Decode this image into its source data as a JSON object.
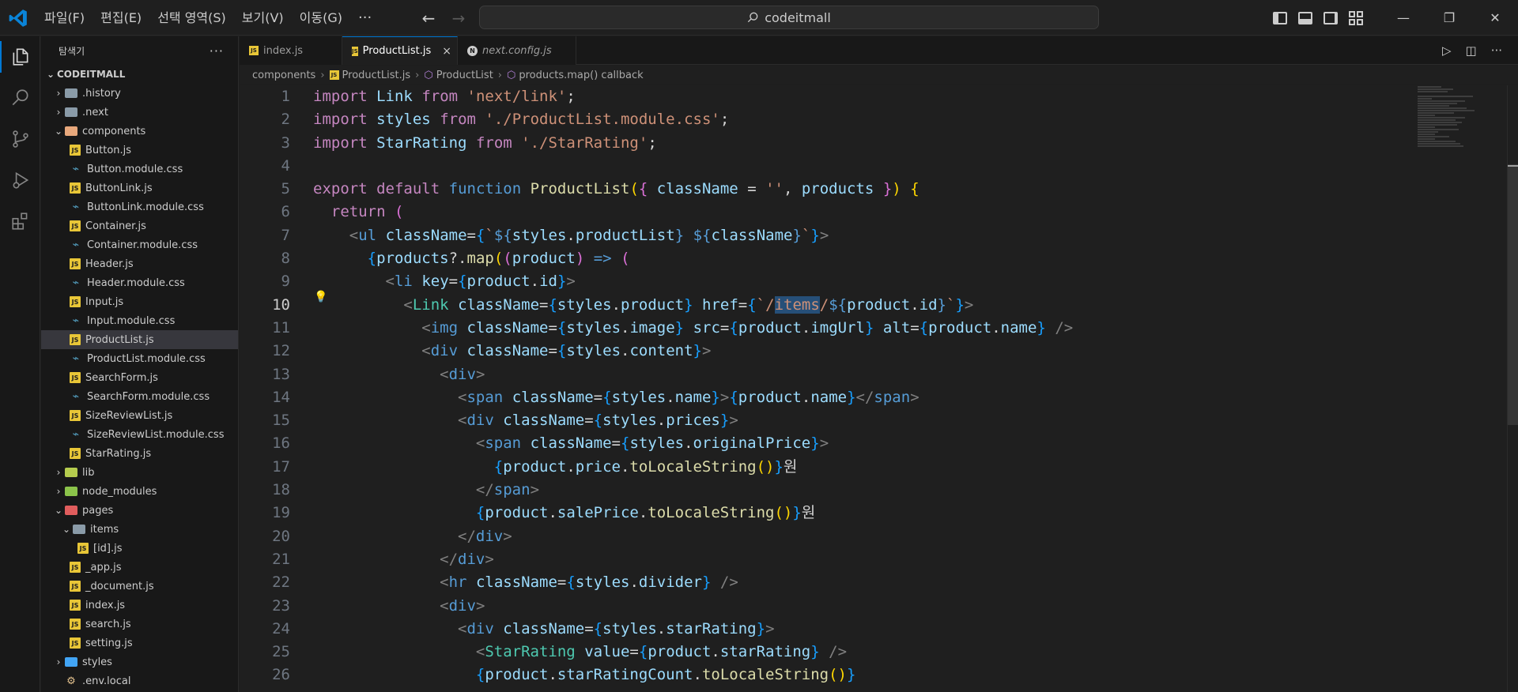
{
  "titlebar": {
    "menu": [
      "파일(F)",
      "편집(E)",
      "선택 영역(S)",
      "보기(V)",
      "이동(G)"
    ],
    "more": "···",
    "search": "codeitmall",
    "controls": {
      "minimize": "—",
      "maximize": "❐",
      "close": "✕"
    }
  },
  "sidebar": {
    "title": "탐색기",
    "more": "···",
    "root": "CODEITMALL",
    "items": [
      {
        "label": ".history",
        "type": "folder",
        "depth": 1,
        "chevron": "›",
        "color": "#8a9ba8"
      },
      {
        "label": ".next",
        "type": "folder",
        "depth": 1,
        "chevron": "›",
        "color": "#8a9ba8"
      },
      {
        "label": "components",
        "type": "folder",
        "depth": 1,
        "chevron": "⌄",
        "color": "#e8a87c"
      },
      {
        "label": "Button.js",
        "type": "js",
        "depth": 2
      },
      {
        "label": "Button.module.css",
        "type": "css",
        "depth": 2
      },
      {
        "label": "ButtonLink.js",
        "type": "js",
        "depth": 2
      },
      {
        "label": "ButtonLink.module.css",
        "type": "css",
        "depth": 2
      },
      {
        "label": "Container.js",
        "type": "js",
        "depth": 2
      },
      {
        "label": "Container.module.css",
        "type": "css",
        "depth": 2
      },
      {
        "label": "Header.js",
        "type": "js",
        "depth": 2
      },
      {
        "label": "Header.module.css",
        "type": "css",
        "depth": 2
      },
      {
        "label": "Input.js",
        "type": "js",
        "depth": 2
      },
      {
        "label": "Input.module.css",
        "type": "css",
        "depth": 2
      },
      {
        "label": "ProductList.js",
        "type": "js",
        "depth": 2,
        "selected": true
      },
      {
        "label": "ProductList.module.css",
        "type": "css",
        "depth": 2
      },
      {
        "label": "SearchForm.js",
        "type": "js",
        "depth": 2
      },
      {
        "label": "SearchForm.module.css",
        "type": "css",
        "depth": 2
      },
      {
        "label": "SizeReviewList.js",
        "type": "js",
        "depth": 2
      },
      {
        "label": "SizeReviewList.module.css",
        "type": "css",
        "depth": 2
      },
      {
        "label": "StarRating.js",
        "type": "js",
        "depth": 2
      },
      {
        "label": "lib",
        "type": "folder",
        "depth": 1,
        "chevron": "›",
        "color": "#b5cc4e"
      },
      {
        "label": "node_modules",
        "type": "folder",
        "depth": 1,
        "chevron": "›",
        "color": "#8bc34a"
      },
      {
        "label": "pages",
        "type": "folder",
        "depth": 1,
        "chevron": "⌄",
        "color": "#e05d5d"
      },
      {
        "label": "items",
        "type": "folder",
        "depth": 2,
        "chevron": "⌄",
        "color": "#8a9ba8"
      },
      {
        "label": "[id].js",
        "type": "js",
        "depth": 3
      },
      {
        "label": "_app.js",
        "type": "js",
        "depth": 2
      },
      {
        "label": "_document.js",
        "type": "js",
        "depth": 2
      },
      {
        "label": "index.js",
        "type": "js",
        "depth": 2
      },
      {
        "label": "search.js",
        "type": "js",
        "depth": 2
      },
      {
        "label": "setting.js",
        "type": "js",
        "depth": 2
      },
      {
        "label": "styles",
        "type": "folder",
        "depth": 1,
        "chevron": "›",
        "color": "#42a5f5"
      },
      {
        "label": ".env.local",
        "type": "env",
        "depth": 1
      }
    ]
  },
  "tabs": [
    {
      "label": "index.js",
      "icon": "js",
      "active": false,
      "italic": false
    },
    {
      "label": "ProductList.js",
      "icon": "js",
      "active": true,
      "italic": false,
      "close": "×"
    },
    {
      "label": "next.config.js",
      "icon": "n",
      "active": false,
      "italic": true
    }
  ],
  "breadcrumb": [
    "components",
    "ProductList.js",
    "ProductList",
    "products.map() callback"
  ],
  "editor": {
    "line_numbers": [
      "1",
      "2",
      "3",
      "4",
      "5",
      "6",
      "7",
      "8",
      "9",
      "10",
      "11",
      "12",
      "13",
      "14",
      "15",
      "16",
      "17",
      "18",
      "19",
      "20",
      "21",
      "22",
      "23",
      "24",
      "25",
      "26"
    ],
    "current_line": 10,
    "colors": {
      "keyword": "#c586c0",
      "string": "#ce9178",
      "function": "#dcdcaa",
      "variable": "#9cdcfe",
      "tag": "#569cd6",
      "component": "#4ec9b0"
    }
  },
  "icons": {
    "logo": "vscode-logo-icon",
    "explorer": "files-icon",
    "search": "search-icon",
    "scm": "source-control-icon",
    "debug": "run-debug-icon",
    "extensions": "extensions-icon"
  }
}
